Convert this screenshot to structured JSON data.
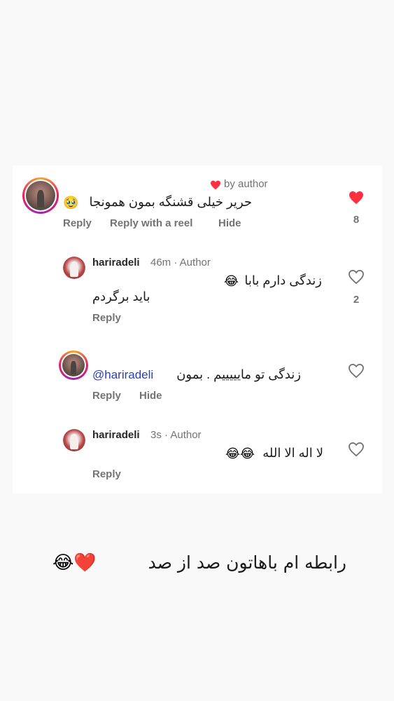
{
  "comment1": {
    "liked_by_author": "by author",
    "text": "حریر خیلی قشنگه بمون همونجا",
    "emoji": "🥹",
    "actions": {
      "reply": "Reply",
      "reply_reel": "Reply with a reel",
      "hide": "Hide"
    },
    "like_count": "8"
  },
  "reply1": {
    "username": "hariradeli",
    "meta": "46m · Author",
    "line1": "زندگی دارم بابا",
    "line1_emoji": "😂",
    "line2": "باید برگردم",
    "actions": {
      "reply": "Reply"
    },
    "like_count": "2"
  },
  "comment2": {
    "mention": "@hariradeli",
    "text": "زندگی تو مایییییم . بمون",
    "actions": {
      "reply": "Reply",
      "hide": "Hide"
    }
  },
  "reply2": {
    "username": "hariradeli",
    "meta": "3s · Author",
    "text": "لا اله الا الله",
    "emoji": "😂😂",
    "actions": {
      "reply": "Reply"
    }
  },
  "caption": {
    "text": "رابطه ام باهاتون صد از صد",
    "emoji": "😂❤️"
  },
  "colors": {
    "like_red": "#ff3040",
    "mention_blue": "#2b3fb6"
  }
}
